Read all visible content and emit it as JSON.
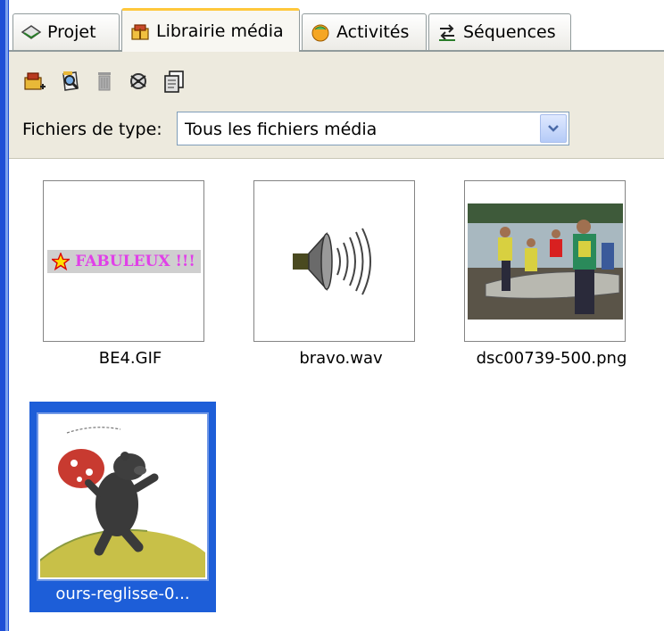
{
  "tabs": [
    {
      "label": "Projet",
      "icon": "project-icon",
      "active": false
    },
    {
      "label": "Librairie média",
      "icon": "media-library-icon",
      "active": true
    },
    {
      "label": "Activités",
      "icon": "activities-icon",
      "active": false
    },
    {
      "label": "Séquences",
      "icon": "sequences-icon",
      "active": false
    }
  ],
  "toolbar": {
    "buttons": [
      "add-media-icon",
      "preview-media-icon",
      "delete-icon",
      "refresh-icon",
      "copy-icon"
    ]
  },
  "filter": {
    "label": "Fichiers de type:",
    "value": "Tous les fichiers média"
  },
  "media": [
    {
      "name": "BE4.GIF",
      "kind": "gif",
      "preview_text": "FABULEUX !!!"
    },
    {
      "name": "bravo.wav",
      "kind": "audio"
    },
    {
      "name": "dsc00739-500.png",
      "kind": "photo"
    },
    {
      "name": "ours-reglisse-0...",
      "kind": "illustration",
      "selected": true
    }
  ],
  "colors": {
    "selection": "#1d5ed8",
    "tab_active_accent": "#ffc83c",
    "toolbar_bg": "#edeade"
  }
}
